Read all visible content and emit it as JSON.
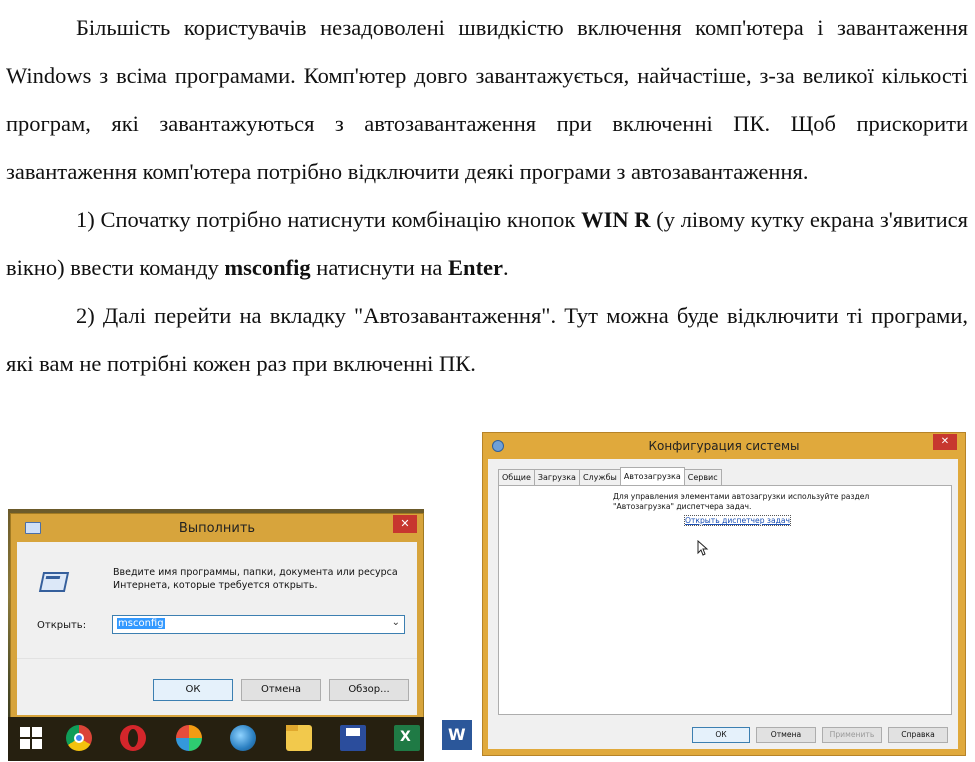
{
  "article": {
    "p1": "Більшість користувачів незадоволені швидкістю включення комп'ютера і завантаження Windows з всіма програмами. Комп'ютер довго завантажується, найчастіше, з-за великої кількості програм, які завантажуються з автозавантаження при включенні ПК. Щоб прискорити завантаження комп'ютера потрібно відключити деякі програми з автозавантаження.",
    "p2_a": "1) Спочатку потрібно натиснути комбінацію кнопок ",
    "p2_keys": "WIN  R",
    "p2_b": " (у лівому кутку екрана з'явитися вікно) ввести команду ",
    "p2_cmd": "msconfig",
    "p2_c": " натиснути на ",
    "p2_enter": "Enter",
    "p2_d": ".",
    "p3": "2) Далі перейти на вкладку \"Автозавантаження\". Тут можна буде відключити ті програми, які вам не потрібні кожен раз при включенні ПК."
  },
  "run_dialog": {
    "title": "Выполнить",
    "close": "✕",
    "description": "Введите имя программы, папки, документа или ресурса Интернета, которые требуется открыть.",
    "open_label": "Открыть:",
    "input_value": "msconfig",
    "dropdown_glyph": "⌄",
    "ok": "ОК",
    "cancel": "Отмена",
    "browse": "Обзор..."
  },
  "taskbar_icons": [
    "windows-start-icon",
    "chrome-icon",
    "opera-icon",
    "colorful-app-icon",
    "browser-globe-icon",
    "folder-icon",
    "save-disk-icon",
    "excel-icon",
    "word-icon"
  ],
  "sysconfig": {
    "title": "Конфигурация системы",
    "close": "✕",
    "tabs": [
      "Общие",
      "Загрузка",
      "Службы",
      "Автозагрузка",
      "Сервис"
    ],
    "info": "Для управления элементами автозагрузки используйте раздел \"Автозагрузка\" диспетчера задач.",
    "link": "Открыть диспетчер задач",
    "ok": "ОК",
    "cancel": "Отмена",
    "apply": "Применить",
    "help": "Справка"
  }
}
